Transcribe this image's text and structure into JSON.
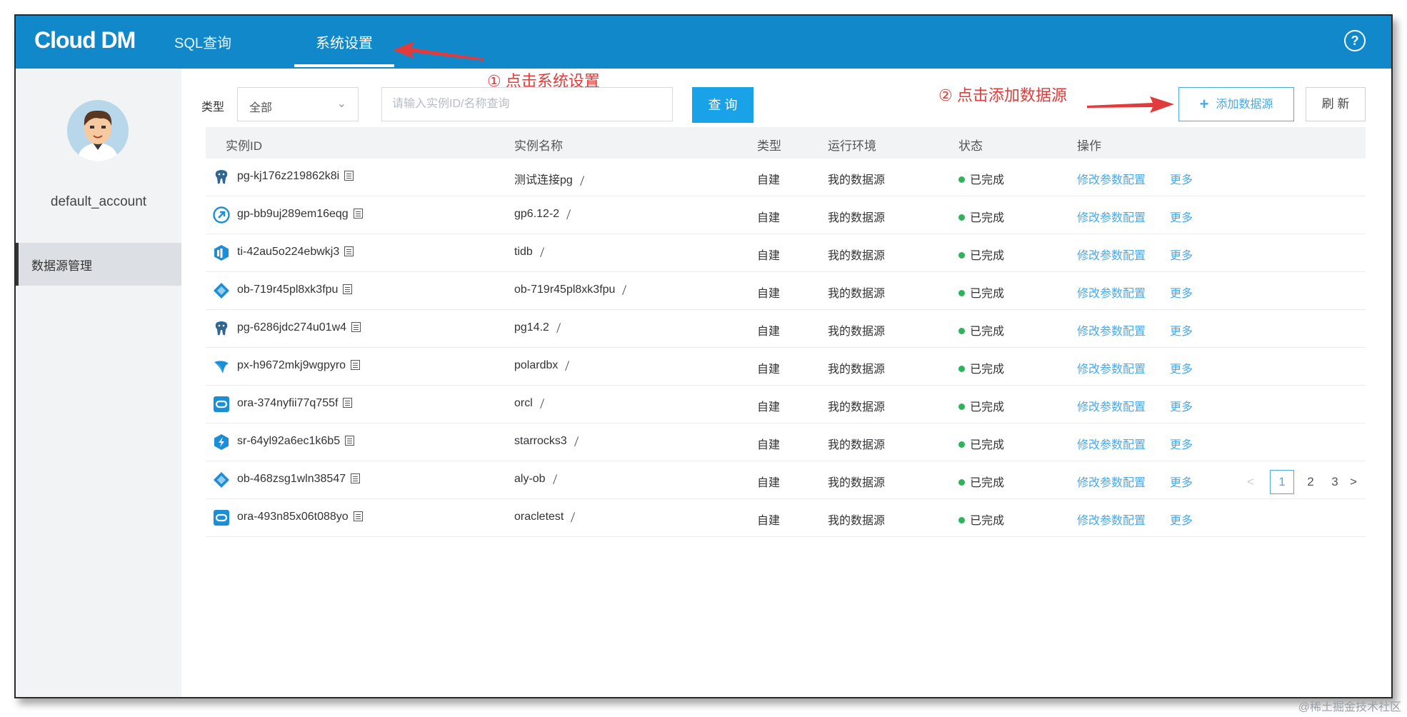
{
  "app": {
    "logo": "Cloud DM"
  },
  "nav": {
    "sql": "SQL查询",
    "settings": "系统设置"
  },
  "annotations": {
    "step1": "① 点击系统设置",
    "step2": "② 点击添加数据源"
  },
  "user": {
    "account": "default_account"
  },
  "sidebar": {
    "menu": "数据源管理"
  },
  "toolbar": {
    "type_label": "类型",
    "type_value": "全部",
    "search_placeholder": "请输入实例ID/名称查询",
    "query": "查 询",
    "add": "添加数据源",
    "refresh": "刷 新"
  },
  "table": {
    "columns": [
      "实例ID",
      "实例名称",
      "类型",
      "运行环境",
      "状态",
      "操作"
    ],
    "op_modify": "修改参数配置",
    "op_more": "更多",
    "rows": [
      {
        "id": "pg-kj176z219862k8i",
        "name": "测试连接pg",
        "type": "自建",
        "env": "我的数据源",
        "status": "已完成",
        "icon": "postgresql-icon"
      },
      {
        "id": "gp-bb9uj289em16eqg",
        "name": "gp6.12-2",
        "type": "自建",
        "env": "我的数据源",
        "status": "已完成",
        "icon": "greenplum-icon"
      },
      {
        "id": "ti-42au5o224ebwkj3",
        "name": "tidb",
        "type": "自建",
        "env": "我的数据源",
        "status": "已完成",
        "icon": "tidb-icon"
      },
      {
        "id": "ob-719r45pl8xk3fpu",
        "name": "ob-719r45pl8xk3fpu",
        "type": "自建",
        "env": "我的数据源",
        "status": "已完成",
        "icon": "oceanbase-icon"
      },
      {
        "id": "pg-6286jdc274u01w4",
        "name": "pg14.2",
        "type": "自建",
        "env": "我的数据源",
        "status": "已完成",
        "icon": "postgresql-icon"
      },
      {
        "id": "px-h9672mkj9wgpyro",
        "name": "polardbx",
        "type": "自建",
        "env": "我的数据源",
        "status": "已完成",
        "icon": "polardbx-icon"
      },
      {
        "id": "ora-374nyfii77q755f",
        "name": "orcl",
        "type": "自建",
        "env": "我的数据源",
        "status": "已完成",
        "icon": "oracle-icon"
      },
      {
        "id": "sr-64yl92a6ec1k6b5",
        "name": "starrocks3",
        "type": "自建",
        "env": "我的数据源",
        "status": "已完成",
        "icon": "starrocks-icon"
      },
      {
        "id": "ob-468zsg1wln38547",
        "name": "aly-ob",
        "type": "自建",
        "env": "我的数据源",
        "status": "已完成",
        "icon": "oceanbase-icon"
      },
      {
        "id": "ora-493n85x06t088yo",
        "name": "oracletest",
        "type": "自建",
        "env": "我的数据源",
        "status": "已完成",
        "icon": "oracle-icon"
      }
    ]
  },
  "pagination": {
    "prev": "<",
    "pages": [
      "1",
      "2",
      "3"
    ],
    "current": "1",
    "next": ">"
  },
  "watermark": "@稀土掘金技术社区",
  "colors": {
    "header": "#1188c9",
    "accent": "#19a2e7",
    "annotation": "#e23b3b",
    "status_ok": "#2fb35a"
  }
}
